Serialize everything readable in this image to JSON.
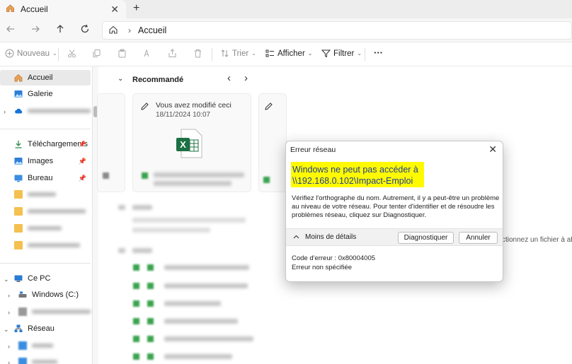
{
  "tab": {
    "title": "Accueil",
    "close": "✕",
    "new": "+"
  },
  "address": {
    "crumb": "Accueil",
    "separator": "›"
  },
  "toolbar": {
    "new_label": "Nouveau",
    "sort_label": "Trier",
    "view_label": "Afficher",
    "filter_label": "Filtrer",
    "more_label": "···"
  },
  "sidebar": {
    "home": "Accueil",
    "gallery": "Galerie",
    "downloads": "Téléchargements",
    "images": "Images",
    "desktop": "Bureau",
    "this_pc": "Ce PC",
    "windows_drive": "Windows  (C:)",
    "network": "Réseau"
  },
  "content": {
    "recommended": "Recommandé",
    "card_title": "Vous avez modifié ceci",
    "card_date": "18/11/2024 10:07",
    "side_hint": "ctionnez un fichier à affic"
  },
  "dialog": {
    "title": "Erreur réseau",
    "heading_line1": "Windows ne peut pas accéder à",
    "heading_line2": "\\\\192.168.0.102\\Impact-Emploi",
    "body": "Vérifiez l'orthographe du nom. Autrement, il y a peut-être un problème au niveau de votre réseau. Pour tenter d'identifier et de résoudre les problèmes réseau, cliquez sur Diagnostiquer.",
    "details_toggle": "Moins de détails",
    "diagnose_button": "Diagnostiquer",
    "cancel_button": "Annuler",
    "error_code": "Code d'erreur : 0x80004005",
    "error_desc": "Erreur non spécifiée"
  },
  "colors": {
    "highlight": "#fffa00",
    "excel": "#1d7044",
    "accent": "#0067c0",
    "folder": "#f4c04f"
  }
}
